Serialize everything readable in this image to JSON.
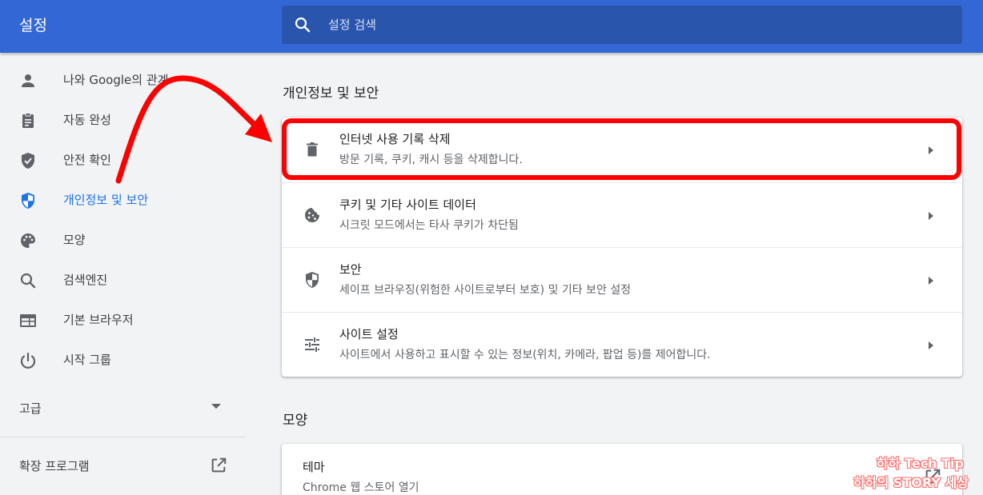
{
  "header": {
    "title": "설정",
    "search_placeholder": "설정 검색"
  },
  "sidebar": {
    "items": [
      {
        "label": "나와 Google의 관계",
        "icon": "person-icon"
      },
      {
        "label": "자동 완성",
        "icon": "clipboard-icon"
      },
      {
        "label": "안전 확인",
        "icon": "shield-check-icon"
      },
      {
        "label": "개인정보 및 보안",
        "icon": "shield-half-icon",
        "active": true
      },
      {
        "label": "모양",
        "icon": "palette-icon"
      },
      {
        "label": "검색엔진",
        "icon": "search-icon"
      },
      {
        "label": "기본 브라우저",
        "icon": "browser-window-icon"
      },
      {
        "label": "시작 그룹",
        "icon": "power-icon"
      }
    ],
    "advanced_label": "고급",
    "extensions_label": "확장 프로그램"
  },
  "privacy": {
    "section_title": "개인정보 및 보안",
    "rows": [
      {
        "title": "인터넷 사용 기록 삭제",
        "subtitle": "방문 기록, 쿠키, 캐시 등을 삭제합니다.",
        "icon": "trash-icon"
      },
      {
        "title": "쿠키 및 기타 사이트 데이터",
        "subtitle": "시크릿 모드에서는 타사 쿠키가 차단됨",
        "icon": "cookie-icon"
      },
      {
        "title": "보안",
        "subtitle": "세이프 브라우징(위험한 사이트로부터 보호) 및 기타 보안 설정",
        "icon": "shield-icon"
      },
      {
        "title": "사이트 설정",
        "subtitle": "사이트에서 사용하고 표시할 수 있는 정보(위치, 카메라, 팝업 등)를 제어합니다.",
        "icon": "tune-icon"
      }
    ]
  },
  "appearance": {
    "section_title": "모양",
    "theme_title": "테마",
    "theme_subtitle": "Chrome 웹 스토어 열기"
  },
  "watermark": {
    "line1": "하하 Tech Tip",
    "line2": "하하의 STORY 세상"
  },
  "colors": {
    "header": "#3367d6",
    "accent": "#1a73e8",
    "annotation": "#ff0000"
  }
}
